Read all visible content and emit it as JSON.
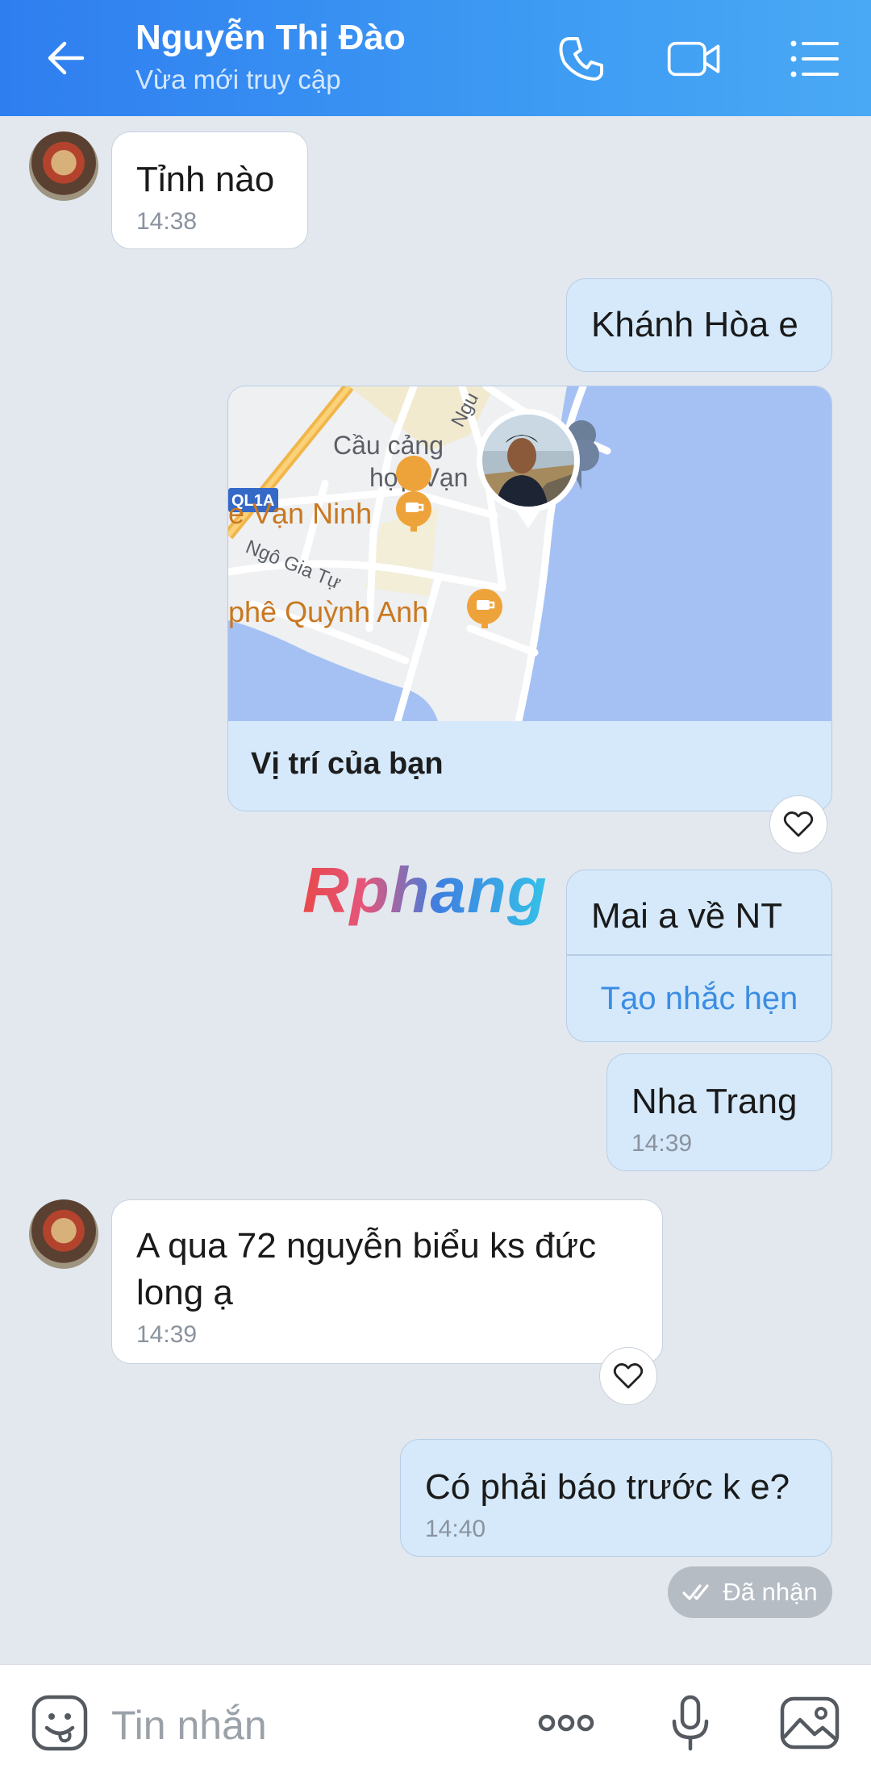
{
  "header": {
    "title": "Nguyễn Thị Đào",
    "subtitle": "Vừa mới truy cập",
    "icons": [
      "back-arrow-icon",
      "phone-icon",
      "video-call-icon",
      "menu-list-icon"
    ]
  },
  "messages": [
    {
      "side": "in",
      "text": "Tỉnh nào",
      "time": "14:38"
    },
    {
      "side": "out",
      "text": "Khánh Hòa e"
    },
    {
      "side": "out",
      "type": "location",
      "label": "Vị trí của bạn",
      "map_text": {
        "place1": "Cầu cảng",
        "place2": "hợp Vạn",
        "road": "QL1A",
        "cafe1": "e Vạn Ninh",
        "street": "Ngô Gia Tự",
        "cafe2": "phê Quỳnh Anh",
        "top_street": "Ngu"
      }
    },
    {
      "side": "out",
      "text": "Mai a về NT",
      "action": "Tạo nhắc hẹn"
    },
    {
      "side": "out",
      "text": "Nha Trang",
      "time": "14:39"
    },
    {
      "side": "in",
      "text": "A qua 72 nguyễn biểu ks đức long ạ",
      "time": "14:39"
    },
    {
      "side": "out",
      "text": "Có phải báo trước k e?",
      "time": "14:40"
    }
  ],
  "status": {
    "label": "Đã nhận"
  },
  "watermark": "Rphang",
  "composer": {
    "placeholder": "Tin nhắn"
  },
  "colors": {
    "header": "#3d9af3",
    "outgoing_bubble": "#d5e9fb",
    "incoming_bubble": "#ffffff",
    "background": "#e3e8ef",
    "link": "#3b8de3"
  }
}
